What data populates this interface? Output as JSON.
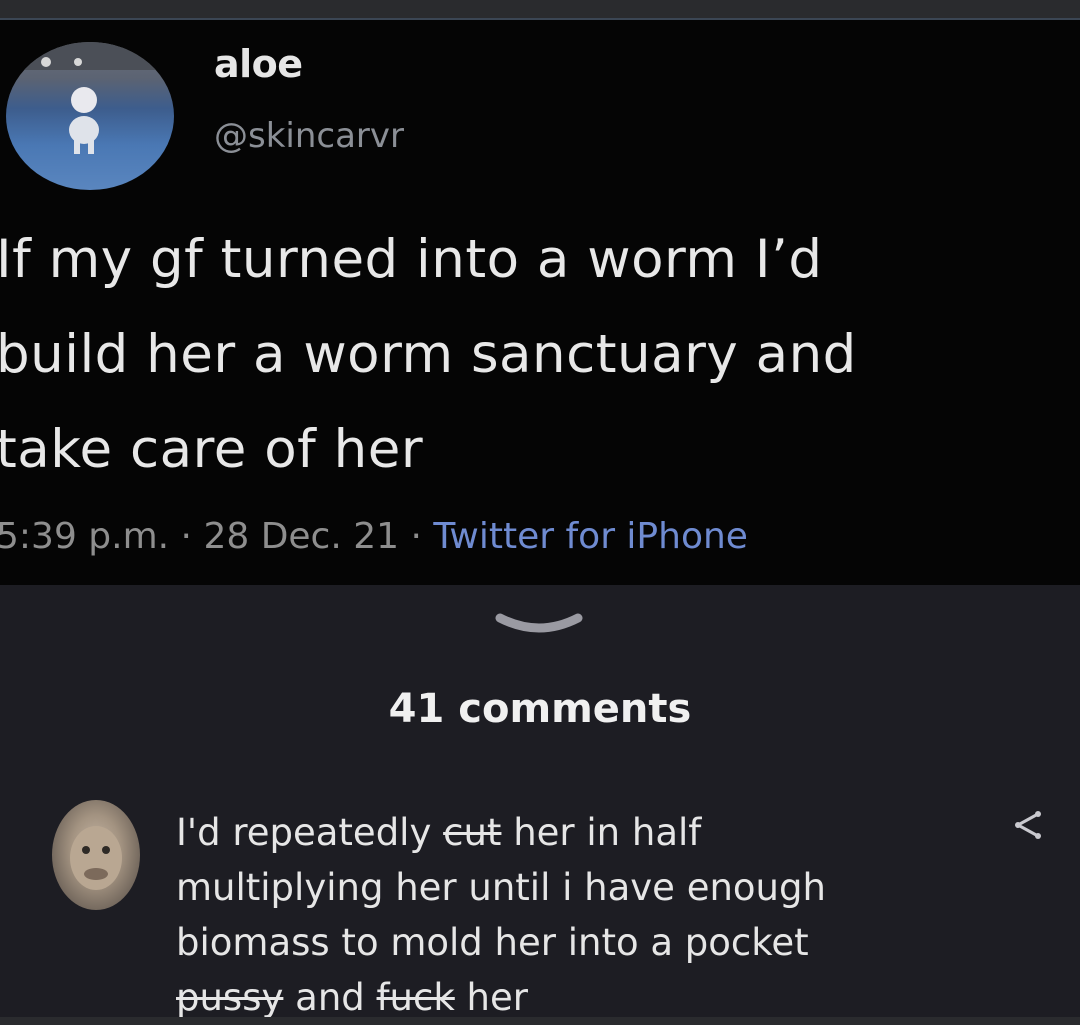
{
  "tweet": {
    "display_name": "aloe",
    "handle": "@skincarvr",
    "lines": [
      "If my gf turned into a worm I’d",
      "build her a worm sanctuary and",
      "take care of her"
    ],
    "time": "5:39 p.m.",
    "date": "28 Dec. 21",
    "source": "Twitter for iPhone",
    "separator": " · "
  },
  "comments": {
    "count_label": "41 comments",
    "top_comment": {
      "line1_pre": "I'd repeatedly ",
      "line1_censored": "cut",
      "line1_post": " her in half",
      "line2": "multiplying her until i have enough",
      "line3": "biomass to mold her into a pocket",
      "line4_censored_a": "pussy",
      "line4_mid": " and ",
      "line4_censored_b": "fuck",
      "line4_post": " her"
    }
  },
  "colors": {
    "accent_link": "#6f8bd1",
    "tweet_bg": "#050505",
    "comments_bg": "#1d1d23"
  },
  "icons": {
    "collapse": "chevron-down-icon",
    "share": "share-icon"
  }
}
